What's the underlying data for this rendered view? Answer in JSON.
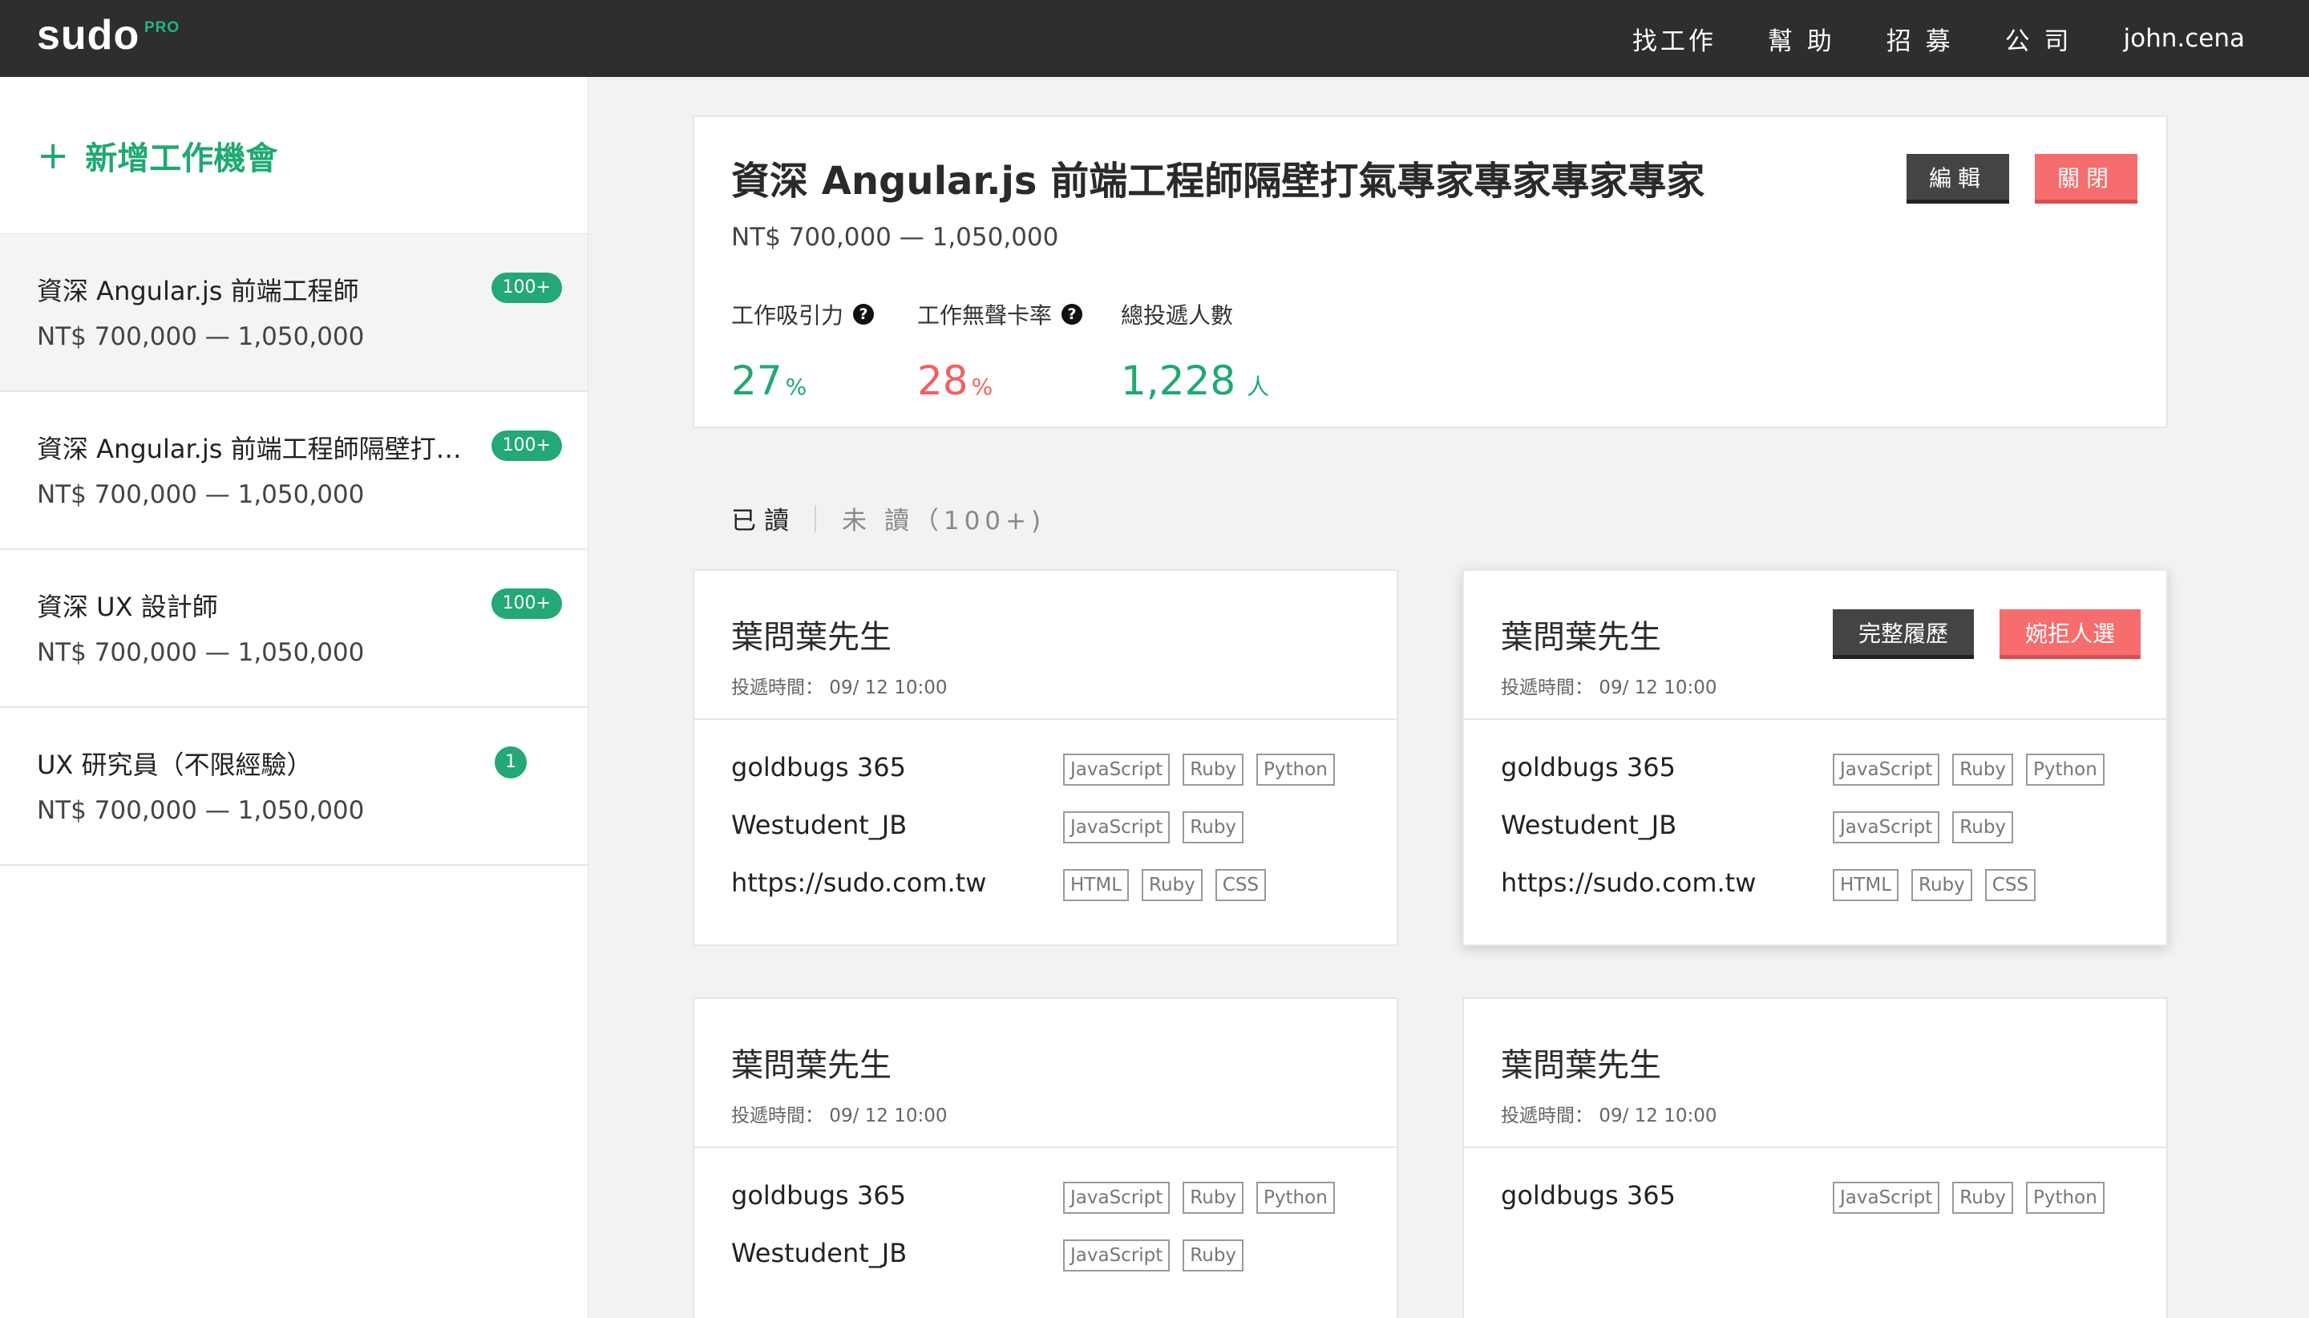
{
  "nav": {
    "logo": "sudo",
    "logo_badge": "PRO",
    "items": [
      "找工作",
      "幫 助",
      "招 募",
      "公 司"
    ],
    "user": "john.cena"
  },
  "sidebar": {
    "add_label": "新增工作機會",
    "jobs": [
      {
        "title": "資深 Angular.js 前端工程師",
        "salary": "NT$ 700,000 — 1,050,000",
        "badge": "100+"
      },
      {
        "title": "資深 Angular.js 前端工程師隔壁打氣專家專家專家專家",
        "salary": "NT$ 700,000 — 1,050,000",
        "badge": "100+"
      },
      {
        "title": "資深 UX 設計師",
        "salary": "NT$ 700,000 — 1,050,000",
        "badge": "100+"
      },
      {
        "title": "UX 研究員（不限經驗）",
        "salary": "NT$ 700,000 — 1,050,000",
        "badge": "1"
      }
    ]
  },
  "job": {
    "title": "資深 Angular.js 前端工程師隔壁打氣專家專家專家專家",
    "salary": "NT$ 700,000 — 1,050,000",
    "edit_label": "編輯",
    "close_label": "關閉",
    "stats": [
      {
        "label": "工作吸引力",
        "value": "27",
        "unit": "%"
      },
      {
        "label": "工作無聲卡率",
        "value": "28",
        "unit": "%"
      },
      {
        "label": "總投遞人數",
        "value": "1,228",
        "unit": "人"
      }
    ]
  },
  "tabs": {
    "read": "已讀",
    "unread": "未 讀（100+)"
  },
  "applicants": [
    {
      "name": "葉問葉先生",
      "time": "投遞時間： 09/ 12 10:00",
      "links": [
        {
          "text": "goldbugs 365",
          "tags": [
            "JavaScript",
            "Ruby",
            "Python"
          ]
        },
        {
          "text": "Westudent_JB",
          "tags": [
            "JavaScript",
            "Ruby"
          ]
        },
        {
          "text": "https://sudo.com.tw",
          "tags": [
            "HTML",
            "Ruby",
            "CSS"
          ]
        }
      ]
    },
    {
      "name": "葉問葉先生",
      "time": "投遞時間： 09/ 12 10:00",
      "resume_label": "完整履歷",
      "reject_label": "婉拒人選",
      "links": [
        {
          "text": "goldbugs 365",
          "tags": [
            "JavaScript",
            "Ruby",
            "Python"
          ]
        },
        {
          "text": "Westudent_JB",
          "tags": [
            "JavaScript",
            "Ruby"
          ]
        },
        {
          "text": "https://sudo.com.tw",
          "tags": [
            "HTML",
            "Ruby",
            "CSS"
          ]
        }
      ]
    },
    {
      "name": "葉問葉先生",
      "time": "投遞時間： 09/ 12 10:00",
      "links": [
        {
          "text": "goldbugs 365",
          "tags": [
            "JavaScript",
            "Ruby",
            "Python"
          ]
        },
        {
          "text": "Westudent_JB",
          "tags": [
            "JavaScript",
            "Ruby"
          ]
        }
      ]
    },
    {
      "name": "葉問葉先生",
      "time": "投遞時間： 09/ 12 10:00",
      "links": [
        {
          "text": "goldbugs 365",
          "tags": [
            "JavaScript",
            "Ruby",
            "Python"
          ]
        }
      ]
    }
  ],
  "colors": {
    "accent_green": "#1fa971",
    "accent_red": "#f45f5f",
    "nav_bg": "#2e2e2e"
  }
}
